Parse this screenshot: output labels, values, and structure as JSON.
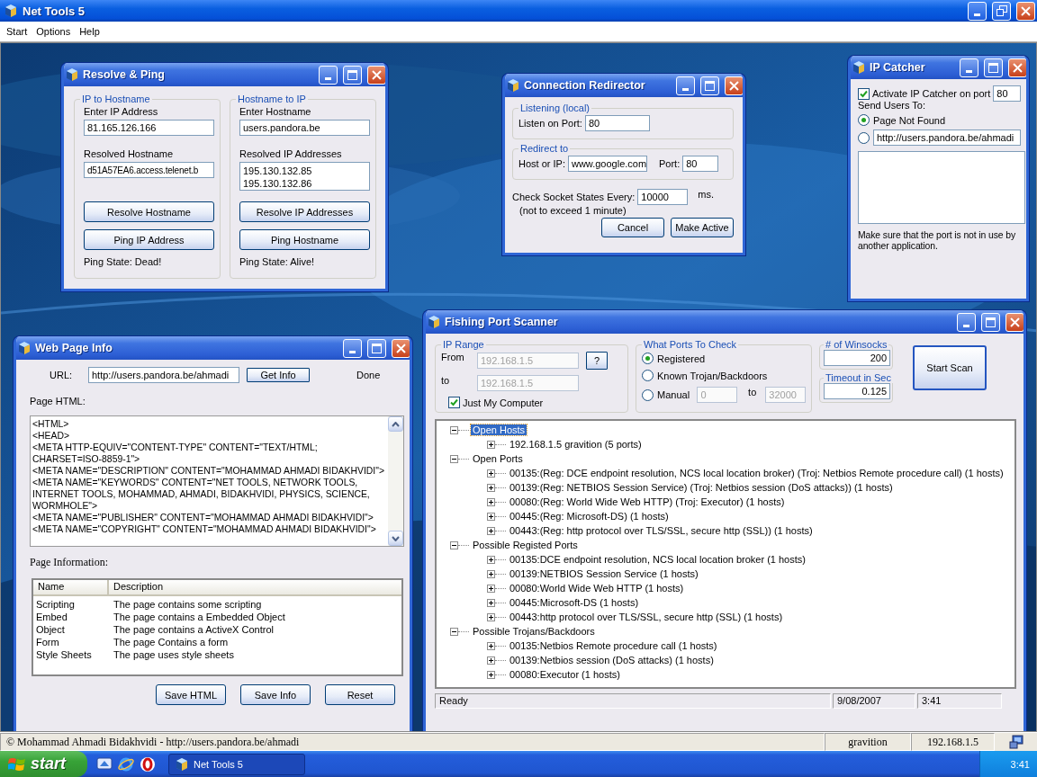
{
  "window": {
    "title": "Net Tools 5"
  },
  "menu": [
    "Start",
    "Options",
    "Help"
  ],
  "resolve_ping": {
    "title": "Resolve & Ping",
    "groups": [
      {
        "heading": "IP to Hostname",
        "input_label": "Enter IP Address",
        "input_value": "81.165.126.166",
        "output_label": "Resolved Hostname",
        "output_lines": [
          "d51A57EA6.access.telenet.b"
        ],
        "buttons": [
          "Resolve Hostname",
          "Ping IP Address"
        ],
        "ping_state": "Ping State: Dead!"
      },
      {
        "heading": "Hostname to IP",
        "input_label": "Enter Hostname",
        "input_value": "users.pandora.be",
        "output_label": "Resolved IP Addresses",
        "output_lines": [
          "195.130.132.85",
          "195.130.132.86"
        ],
        "buttons": [
          "Resolve IP Addresses",
          "Ping Hostname"
        ],
        "ping_state": "Ping State: Alive!"
      }
    ]
  },
  "redirector": {
    "title": "Connection Redirector",
    "listening": {
      "heading": "Listening (local)",
      "port_label": "Listen on Port:",
      "port": "80"
    },
    "redirect": {
      "heading": "Redirect to",
      "host_label": "Host or IP:",
      "host": "www.google.com",
      "port_label": "Port:",
      "port": "80"
    },
    "check_label": "Check Socket States Every:",
    "check_value": "10000",
    "unit": "ms.",
    "note": "(not to exceed 1 minute)",
    "buttons": [
      "Cancel",
      "Make Active"
    ]
  },
  "ip_catcher": {
    "title": "IP Catcher",
    "activate": {
      "label": "Activate IP Catcher on port",
      "checked": true,
      "port": "80"
    },
    "send_label": "Send Users To:",
    "options": [
      {
        "kind": "text",
        "label": "Page Not Found",
        "selected": true
      },
      {
        "kind": "field",
        "value": "http://users.pandora.be/ahmadi",
        "selected": false
      }
    ],
    "note": "Make sure that the port is not in use by another application."
  },
  "web_page_info": {
    "title": "Web Page Info",
    "url_label": "URL:",
    "url": "http://users.pandora.be/ahmadi",
    "get_button": "Get Info",
    "status": "Done",
    "html_label": "Page HTML:",
    "html_lines": [
      "<HTML>",
      "<HEAD>",
      "<META HTTP-EQUIV=\"CONTENT-TYPE\" CONTENT=\"TEXT/HTML;",
      "CHARSET=ISO-8859-1\">",
      "<META NAME=\"DESCRIPTION\" CONTENT=\"MOHAMMAD AHMADI BIDAKHVIDI\">",
      "<META NAME=\"KEYWORDS\" CONTENT=\"NET TOOLS, NETWORK TOOLS,",
      "INTERNET TOOLS, MOHAMMAD, AHMADI, BIDAKHVIDI, PHYSICS, SCIENCE,",
      "WORMHOLE\">",
      "<META NAME=\"PUBLISHER\" CONTENT=\"MOHAMMAD AHMADI BIDAKHVIDI\">",
      "<META NAME=\"COPYRIGHT\" CONTENT=\"MOHAMMAD AHMADI BIDAKHVIDI\">"
    ],
    "info_label": "Page Information:",
    "columns": [
      "Name",
      "Description"
    ],
    "rows": [
      [
        "Scripting",
        "The page contains some scripting"
      ],
      [
        "Embed",
        "The page contains a Embedded Object"
      ],
      [
        "Object",
        "The page contains a ActiveX Control"
      ],
      [
        "Form",
        "The page Contains a form"
      ],
      [
        "Style Sheets",
        "The page uses style sheets"
      ]
    ],
    "buttons": [
      "Save HTML",
      "Save Info",
      "Reset"
    ]
  },
  "port_scanner": {
    "title": "Fishing Port Scanner",
    "ip_range": {
      "heading": "IP Range",
      "from_label": "From",
      "from": {
        "value": "192.168.1.5",
        "disabled": true
      },
      "to_label": "to",
      "to": {
        "value": "192.168.1.5",
        "disabled": true
      },
      "help_button": "?",
      "just_my_computer": {
        "label": "Just My Computer",
        "checked": true
      }
    },
    "ports": {
      "heading": "What Ports To Check",
      "options": [
        {
          "label": "Registered",
          "selected": true
        },
        {
          "label": "Known Trojan/Backdoors",
          "selected": false
        },
        {
          "label": "Manual",
          "selected": false
        }
      ],
      "manual_from": {
        "value": "0",
        "disabled": true
      },
      "to_label": "to",
      "manual_to": {
        "value": "32000",
        "disabled": true
      }
    },
    "winsocks": {
      "heading": "# of Winsocks",
      "value": "200"
    },
    "timeout": {
      "heading": "Timeout in Sec",
      "value": "0.125"
    },
    "start_button": "Start Scan",
    "tree": [
      {
        "label": "Open Hosts",
        "expanded": true,
        "selected": true,
        "children": [
          {
            "label": "192.168.1.5 gravition (5 ports)",
            "expanded": false,
            "selected": false
          }
        ]
      },
      {
        "label": "Open Ports",
        "expanded": true,
        "selected": false,
        "children": [
          {
            "label": "00135:(Reg: DCE endpoint resolution, NCS local location broker) (Troj: Netbios Remote procedure call) (1 hosts)",
            "expanded": false,
            "selected": false
          },
          {
            "label": "00139:(Reg: NETBIOS Session Service) (Troj: Netbios session (DoS attacks)) (1 hosts)",
            "expanded": false,
            "selected": false
          },
          {
            "label": "00080:(Reg: World Wide Web HTTP) (Troj: Executor) (1 hosts)",
            "expanded": false,
            "selected": false
          },
          {
            "label": "00445:(Reg: Microsoft-DS)  (1 hosts)",
            "expanded": false,
            "selected": false
          },
          {
            "label": "00443:(Reg: http protocol over TLS/SSL, secure http (SSL))  (1 hosts)",
            "expanded": false,
            "selected": false
          }
        ]
      },
      {
        "label": "Possible Registed Ports",
        "expanded": true,
        "selected": false,
        "children": [
          {
            "label": "00135:DCE endpoint resolution, NCS local location broker (1 hosts)",
            "expanded": false,
            "selected": false
          },
          {
            "label": "00139:NETBIOS Session Service (1 hosts)",
            "expanded": false,
            "selected": false
          },
          {
            "label": "00080:World Wide Web HTTP (1 hosts)",
            "expanded": false,
            "selected": false
          },
          {
            "label": "00445:Microsoft-DS (1 hosts)",
            "expanded": false,
            "selected": false
          },
          {
            "label": "00443:http protocol over TLS/SSL, secure http (SSL) (1 hosts)",
            "expanded": false,
            "selected": false
          }
        ]
      },
      {
        "label": "Possible Trojans/Backdoors",
        "expanded": true,
        "selected": false,
        "children": [
          {
            "label": "00135:Netbios Remote procedure call (1 hosts)",
            "expanded": false,
            "selected": false
          },
          {
            "label": "00139:Netbios session (DoS attacks) (1 hosts)",
            "expanded": false,
            "selected": false
          },
          {
            "label": "00080:Executor (1 hosts)",
            "expanded": false,
            "selected": false
          }
        ]
      }
    ],
    "status": [
      "Ready",
      "9/08/2007",
      "3:41"
    ]
  },
  "status_bar": {
    "text": "© Mohammad Ahmadi Bidakhvidi - http://users.pandora.be/ahmadi",
    "host": "gravition",
    "ip": "192.168.1.5"
  },
  "taskbar": {
    "start": "start",
    "tasks": [
      "Net Tools 5"
    ],
    "clock": "3:41"
  }
}
